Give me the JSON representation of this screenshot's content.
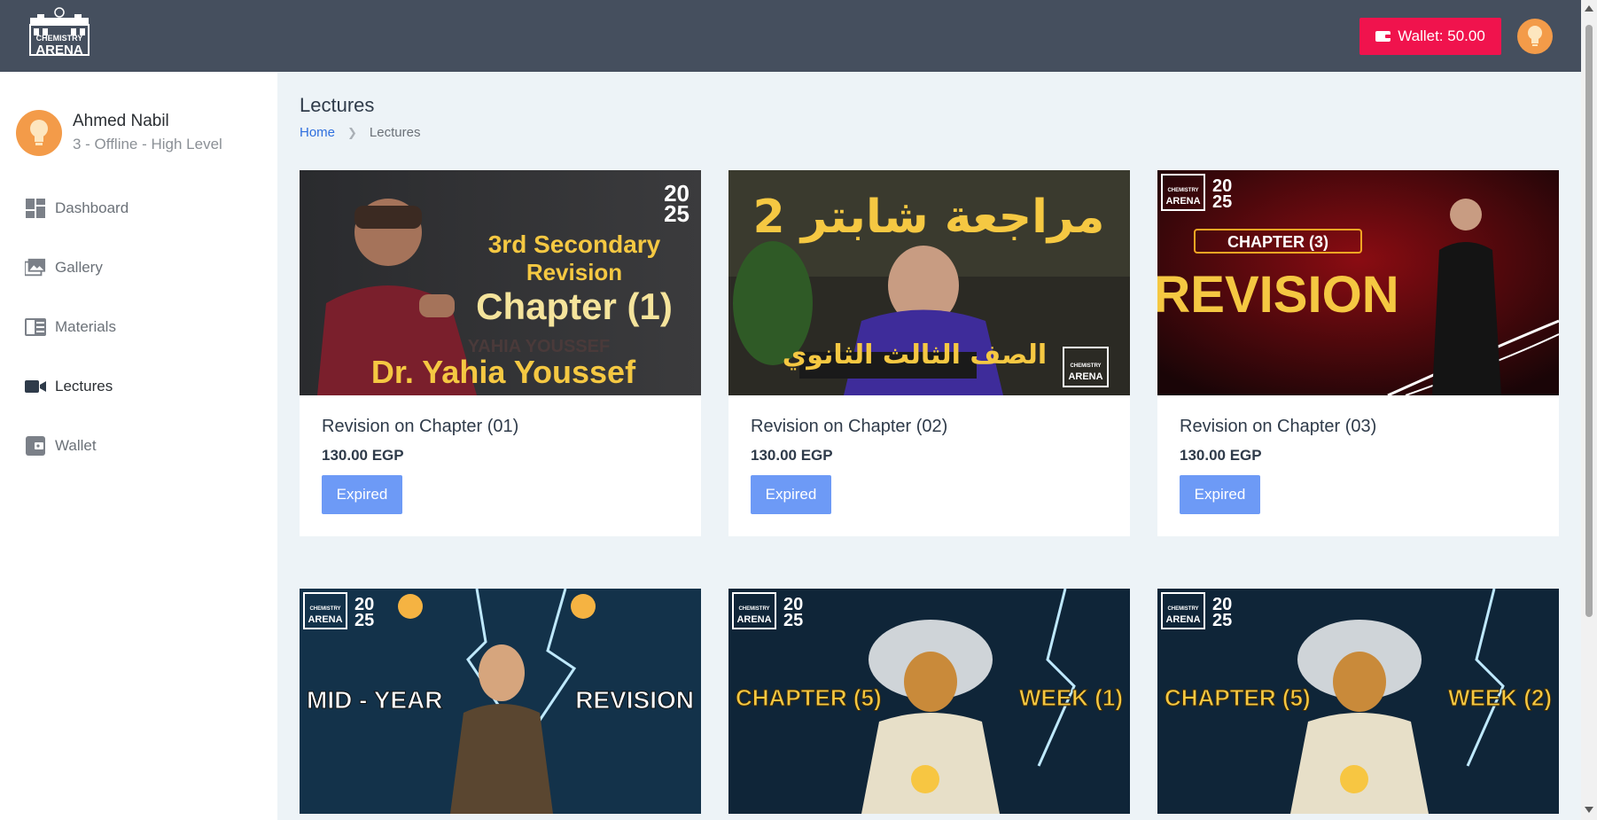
{
  "header": {
    "logo_text_top": "CHEMISTRY",
    "logo_text_bottom": "ARENA",
    "wallet_label": "Wallet: 50.00",
    "wallet_icon": "wallet-icon",
    "accent_color": "#f0134d"
  },
  "user": {
    "name": "Ahmed Nabil",
    "subtitle": "3 - Offline - High Level"
  },
  "sidebar": {
    "items": [
      {
        "label": "Dashboard",
        "icon": "dashboard-icon"
      },
      {
        "label": "Gallery",
        "icon": "gallery-icon"
      },
      {
        "label": "Materials",
        "icon": "materials-icon"
      },
      {
        "label": "Lectures",
        "icon": "video-camera-icon",
        "active": true
      },
      {
        "label": "Wallet",
        "icon": "wallet-icon"
      }
    ]
  },
  "page": {
    "title": "Lectures",
    "breadcrumb": [
      "Home",
      "Lectures"
    ]
  },
  "lectures": [
    {
      "title": "Revision on Chapter (01)",
      "price": "130.00 EGP",
      "status": "Expired",
      "thumb": {
        "year_top": "20",
        "year_bottom": "25",
        "line1": "3rd Secondary",
        "line2": "Revision",
        "line3": "Chapter (1)",
        "line4": "Dr. Yahia Youssef",
        "bg_text": "YAHIA YOUSSEF"
      }
    },
    {
      "title": "Revision on Chapter (02)",
      "price": "130.00 EGP",
      "status": "Expired",
      "thumb": {
        "headline": "مراجعة شابتر 2",
        "subline": "الصف الثالث الثانوي",
        "logo_top": "CHEMISTRY",
        "logo_bottom": "ARENA"
      }
    },
    {
      "title": "Revision on Chapter (03)",
      "price": "130.00 EGP",
      "status": "Expired",
      "thumb": {
        "year_top": "20",
        "year_bottom": "25",
        "chapter": "CHAPTER (3)",
        "headline": "REVISION",
        "logo_top": "CHEMISTRY",
        "logo_bottom": "ARENA"
      }
    },
    {
      "thumb": {
        "year_top": "20",
        "year_bottom": "25",
        "left_text": "MID - YEAR",
        "right_text": "REVISION",
        "logo_top": "CHEMISTRY",
        "logo_bottom": "ARENA"
      }
    },
    {
      "thumb": {
        "year_top": "20",
        "year_bottom": "25",
        "left_text": "CHAPTER (5)",
        "right_text": "WEEK (1)",
        "logo_top": "CHEMISTRY",
        "logo_bottom": "ARENA"
      }
    },
    {
      "thumb": {
        "year_top": "20",
        "year_bottom": "25",
        "left_text": "CHAPTER (5)",
        "right_text": "WEEK (2)",
        "logo_top": "CHEMISTRY",
        "logo_bottom": "ARENA"
      }
    }
  ]
}
